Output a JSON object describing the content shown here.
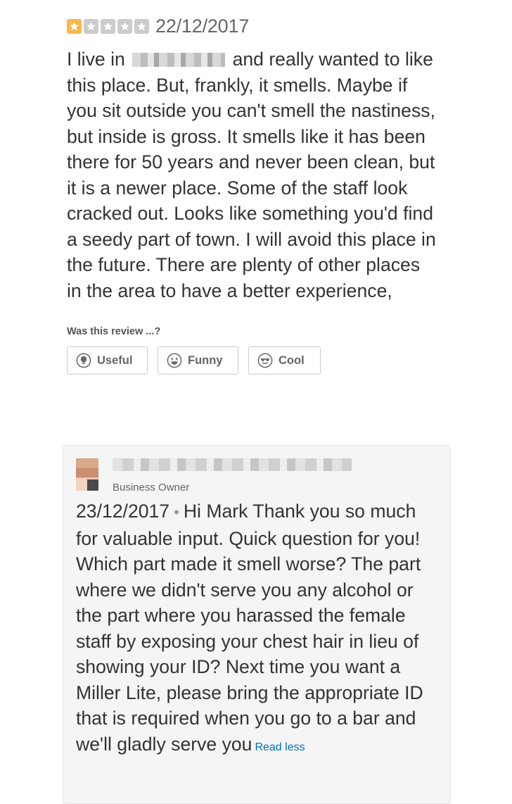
{
  "review": {
    "rating": 1,
    "rating_max": 5,
    "star_filled_color": "#f8b84e",
    "star_empty_color": "#cccccc",
    "date": "22/12/2017",
    "text_before_redaction": "I live in",
    "text_after_redaction": "and really wanted to like this place. But, frankly, it smells. Maybe if you sit outside you can't smell the nastiness, but inside is gross. It smells like it has been there for 50 years and never been clean, but it is a newer place. Some of the staff look cracked out. Looks like something you'd find a seedy part of town. I will avoid this place in the future. There are plenty of other places in the area to have a better experience,"
  },
  "feedback": {
    "prompt": "Was this review ...?",
    "buttons": [
      {
        "label": "Useful",
        "icon": "lightbulb-icon"
      },
      {
        "label": "Funny",
        "icon": "smiley-icon"
      },
      {
        "label": "Cool",
        "icon": "sunglasses-icon"
      }
    ]
  },
  "owner_reply": {
    "role": "Business Owner",
    "date": "23/12/2017",
    "separator": "•",
    "text": "Hi Mark Thank you so much for valuable input. Quick question for you! Which part made it smell worse? The part where we didn't serve you any alcohol or the part where you harassed the female staff by exposing your chest hair in lieu of showing your ID? Next time you want a Miller Lite, please bring the appropriate ID that is required when you go to a bar and we'll gladly serve you",
    "read_less_label": "Read less",
    "link_color": "#0073bb"
  }
}
